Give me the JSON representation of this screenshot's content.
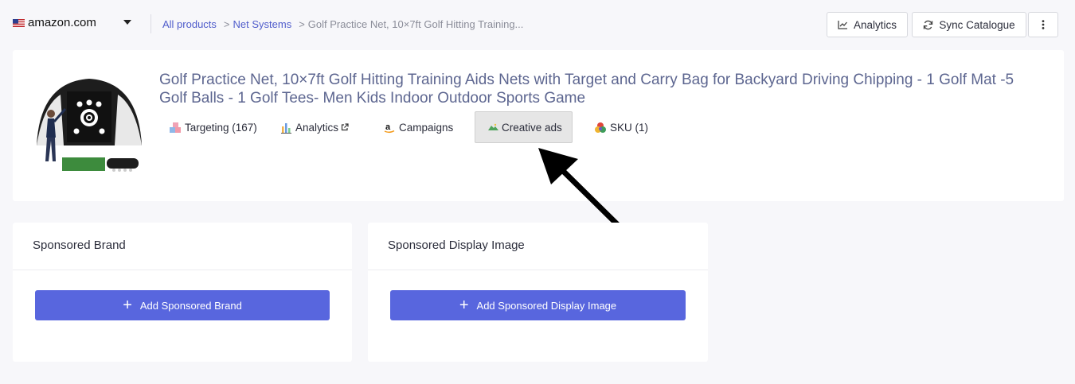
{
  "header": {
    "store_name": "amazon.com",
    "breadcrumb": {
      "root": "All products",
      "category": "Net Systems",
      "current": "Golf Practice Net, 10×7ft Golf Hitting Training..."
    },
    "buttons": {
      "analytics": "Analytics",
      "sync": "Sync Catalogue"
    }
  },
  "product": {
    "title": "Golf Practice Net, 10×7ft Golf Hitting Training Aids Nets with Target and Carry Bag for Backyard Driving Chipping - 1 Golf Mat -5 Golf Balls - 1 Golf Tees- Men Kids Indoor Outdoor Sports Game",
    "tabs": {
      "targeting": "Targeting (167)",
      "analytics": "Analytics",
      "campaigns": "Campaigns",
      "creative": "Creative ads",
      "sku": "SKU (1)"
    },
    "active_tab": "creative"
  },
  "cards": {
    "brand": {
      "title": "Sponsored Brand",
      "button": "Add Sponsored Brand"
    },
    "display": {
      "title": "Sponsored Display Image",
      "button": "Add Sponsored Display Image"
    }
  },
  "colors": {
    "accent": "#5866de",
    "link": "#4f5ccb",
    "title": "#5d6690",
    "active_tab_bg": "#e6e6e6"
  },
  "icons": {
    "flag": "us-flag-icon",
    "dropdown": "caret-down-icon",
    "analytics": "line-chart-icon",
    "sync": "refresh-icon",
    "more": "vertical-dots-icon",
    "targeting": "blocks-icon",
    "tab_analytics": "bar-chart-icon",
    "external": "external-link-icon",
    "campaigns": "amazon-icon",
    "creative": "mountain-image-icon",
    "sku": "color-circles-icon",
    "add": "plus-icon"
  }
}
